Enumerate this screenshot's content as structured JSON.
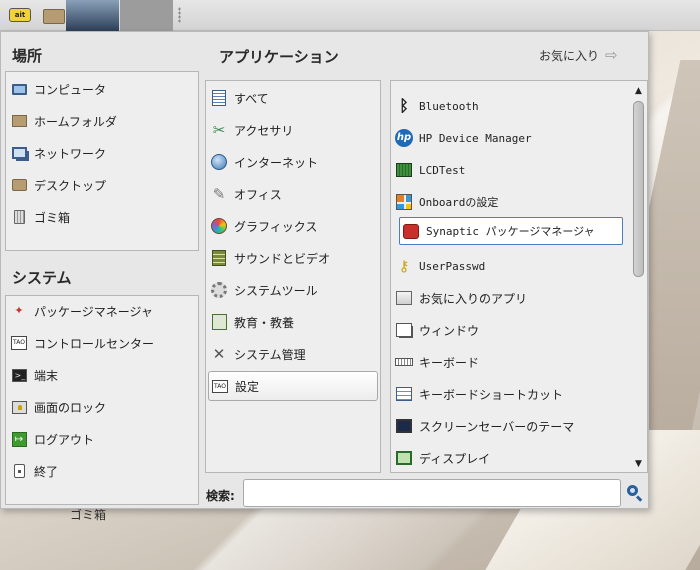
{
  "places": {
    "title": "場所",
    "items": [
      {
        "label": "コンピュータ",
        "icon": "computer-icon"
      },
      {
        "label": "ホームフォルダ",
        "icon": "home-folder-icon"
      },
      {
        "label": "ネットワーク",
        "icon": "network-icon"
      },
      {
        "label": "デスクトップ",
        "icon": "desktop-folder-icon"
      },
      {
        "label": "ゴミ箱",
        "icon": "trash-icon"
      }
    ]
  },
  "system": {
    "title": "システム",
    "items": [
      {
        "label": "パッケージマネージャ",
        "icon": "package-manager-icon"
      },
      {
        "label": "コントロールセンター",
        "icon": "control-center-icon"
      },
      {
        "label": "端末",
        "icon": "terminal-icon"
      },
      {
        "label": "画面のロック",
        "icon": "lock-screen-icon"
      },
      {
        "label": "ログアウト",
        "icon": "logout-icon"
      },
      {
        "label": "終了",
        "icon": "shutdown-icon"
      }
    ]
  },
  "applications": {
    "title": "アプリケーション",
    "favorites_label": "お気に入り",
    "categories": [
      {
        "label": "すべて",
        "icon": "all-apps-icon"
      },
      {
        "label": "アクセサリ",
        "icon": "accessories-icon"
      },
      {
        "label": "インターネット",
        "icon": "internet-icon"
      },
      {
        "label": "オフィス",
        "icon": "office-icon"
      },
      {
        "label": "グラフィックス",
        "icon": "graphics-icon"
      },
      {
        "label": "サウンドとビデオ",
        "icon": "sound-video-icon"
      },
      {
        "label": "システムツール",
        "icon": "system-tools-icon"
      },
      {
        "label": "教育・教養",
        "icon": "education-icon"
      },
      {
        "label": "システム管理",
        "icon": "administration-icon"
      },
      {
        "label": "設定",
        "icon": "settings-icon",
        "selected": true
      }
    ],
    "apps": [
      {
        "label": "Bluetooth",
        "icon": "bluetooth-icon"
      },
      {
        "label": "HP Device Manager",
        "icon": "hp-icon"
      },
      {
        "label": "LCDTest",
        "icon": "lcdtest-icon"
      },
      {
        "label": "Onboardの設定",
        "icon": "onboard-icon"
      },
      {
        "label": "Synaptic パッケージマネージャ",
        "icon": "synaptic-icon",
        "focused": true
      },
      {
        "label": "UserPasswd",
        "icon": "key-icon"
      },
      {
        "label": "お気に入りのアプリ",
        "icon": "favorite-apps-icon"
      },
      {
        "label": "ウィンドウ",
        "icon": "window-icon"
      },
      {
        "label": "キーボード",
        "icon": "keyboard-icon"
      },
      {
        "label": "キーボードショートカット",
        "icon": "keyboard-shortcuts-icon"
      },
      {
        "label": "スクリーンセーバーのテーマ",
        "icon": "screensaver-icon"
      },
      {
        "label": "ディスプレイ",
        "icon": "display-icon"
      }
    ]
  },
  "search": {
    "label": "検索:",
    "value": "",
    "placeholder": ""
  },
  "desktop": {
    "partial_label": "ゴミ箱"
  },
  "colors": {
    "focus_border": "#4a7fbf",
    "panel_active": "#2c3f57"
  }
}
